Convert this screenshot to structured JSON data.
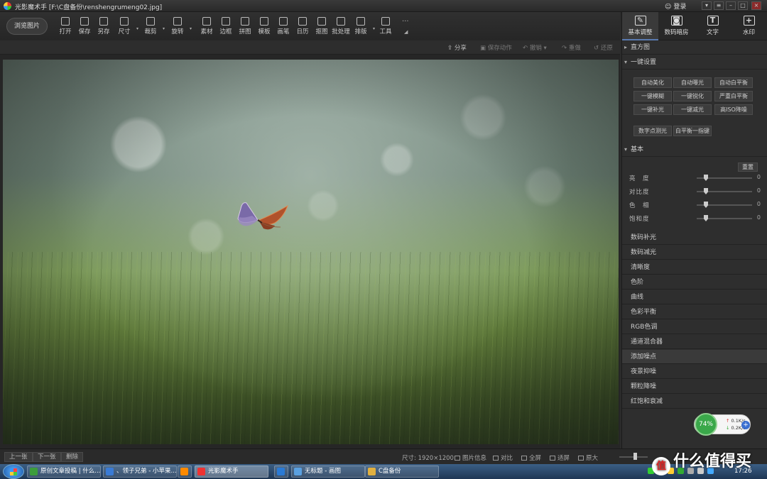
{
  "app": {
    "title": "光影魔术手 [F:\\C盘备份\\renshengrumeng02.jpg]",
    "login": "登录"
  },
  "toolbar": {
    "browse": "浏览图片",
    "tools": [
      {
        "label": "打开",
        "icon": "open-icon"
      },
      {
        "label": "保存",
        "icon": "save-icon"
      },
      {
        "label": "另存",
        "icon": "save-as-icon"
      },
      {
        "label": "尺寸",
        "icon": "resize-icon"
      },
      {
        "label": "裁剪",
        "icon": "crop-icon"
      },
      {
        "label": "旋转",
        "icon": "rotate-icon"
      },
      {
        "label": "素材",
        "icon": "material-icon"
      },
      {
        "label": "边框",
        "icon": "border-icon"
      },
      {
        "label": "拼图",
        "icon": "collage-icon"
      },
      {
        "label": "模板",
        "icon": "template-icon"
      },
      {
        "label": "画笔",
        "icon": "brush-icon"
      },
      {
        "label": "日历",
        "icon": "calendar-icon"
      },
      {
        "label": "抠图",
        "icon": "cutout-icon"
      },
      {
        "label": "批处理",
        "icon": "batch-icon"
      },
      {
        "label": "排版",
        "icon": "layout-icon"
      },
      {
        "label": "工具",
        "icon": "wrench-icon"
      }
    ],
    "more": "···"
  },
  "actions": {
    "share": "分享",
    "save_action": "保存动作",
    "undo": "撤销",
    "redo": "重做",
    "restore": "还原"
  },
  "right_tabs": [
    {
      "label": "基本调整",
      "icon": "edit-icon"
    },
    {
      "label": "数码暗房",
      "icon": "camera-icon"
    },
    {
      "label": "文字",
      "icon": "text-icon"
    },
    {
      "label": "水印",
      "icon": "watermark-icon"
    }
  ],
  "panel": {
    "histogram": "直方图",
    "oneclick_title": "一键设置",
    "oneclick_buttons": [
      "自动美化",
      "自动曝光",
      "自动白平衡",
      "一键模糊",
      "一键锐化",
      "严重白平衡",
      "一键补光",
      "一键减光",
      "高ISO降噪"
    ],
    "extra_buttons": [
      "数字点测光",
      "白平衡一指键"
    ],
    "basic_title": "基本",
    "reset": "重置",
    "sliders": [
      {
        "label": "亮　度",
        "value": "0"
      },
      {
        "label": "对比度",
        "value": "0"
      },
      {
        "label": "色　相",
        "value": "0"
      },
      {
        "label": "饱和度",
        "value": "0"
      }
    ],
    "sections": [
      "数码补光",
      "数码减光",
      "清晰度",
      "色阶",
      "曲线",
      "色彩平衡",
      "RGB色调",
      "通道混合器",
      "添加噪点",
      "夜景抑噪",
      "颗粒降噪",
      "红饱和衰减"
    ],
    "highlighted_section": "添加噪点"
  },
  "status": {
    "prev": "上一张",
    "next": "下一张",
    "delete": "删除",
    "size": "尺寸: 1920×1200",
    "info": "图片信息",
    "compare": "对比",
    "fullscreen": "全屏",
    "fit": "适屏",
    "original": "原大"
  },
  "network": {
    "percent": "74%",
    "up": "0.1K/s",
    "down": "0.2K/s"
  },
  "taskbar": {
    "items": [
      {
        "label": "原创文章投稿 | 什么...",
        "color": "#3c9d3c"
      },
      {
        "label": "、领子兄弟 - 小苹果...",
        "color": "#3a7bd5"
      },
      {
        "label": "",
        "color": "#ff8a00"
      },
      {
        "label": "光影魔术手",
        "color": "#e33"
      },
      {
        "label": "",
        "color": "#2a7ad5"
      },
      {
        "label": "无标题 - 画图",
        "color": "#5aa0e0"
      },
      {
        "label": "C盘备份",
        "color": "#e0b040"
      }
    ],
    "time": "17:26"
  },
  "watermark": {
    "badge": "值",
    "text": "什么值得买"
  }
}
